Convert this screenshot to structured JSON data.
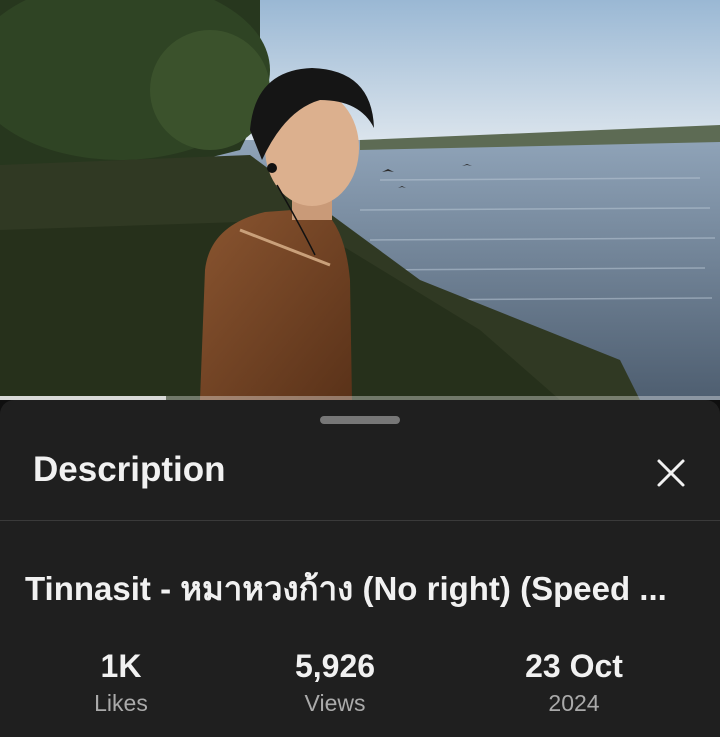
{
  "video": {
    "thumbnail": "video-frame-person-by-lake",
    "progress": 0.23
  },
  "sheet": {
    "title": "Description",
    "close_icon": "close-icon"
  },
  "description": {
    "video_title": "Tinnasit - หมาหวงก้าง (No right) (Speed ...",
    "stats": [
      {
        "value": "1K",
        "label": "Likes"
      },
      {
        "value": "5,926",
        "label": "Views"
      },
      {
        "value": "23 Oct",
        "label": "2024"
      }
    ]
  },
  "colors": {
    "sheet_bg": "#1f1f1f",
    "text_primary": "#f1f1f1",
    "text_secondary": "#aaaaaa"
  }
}
